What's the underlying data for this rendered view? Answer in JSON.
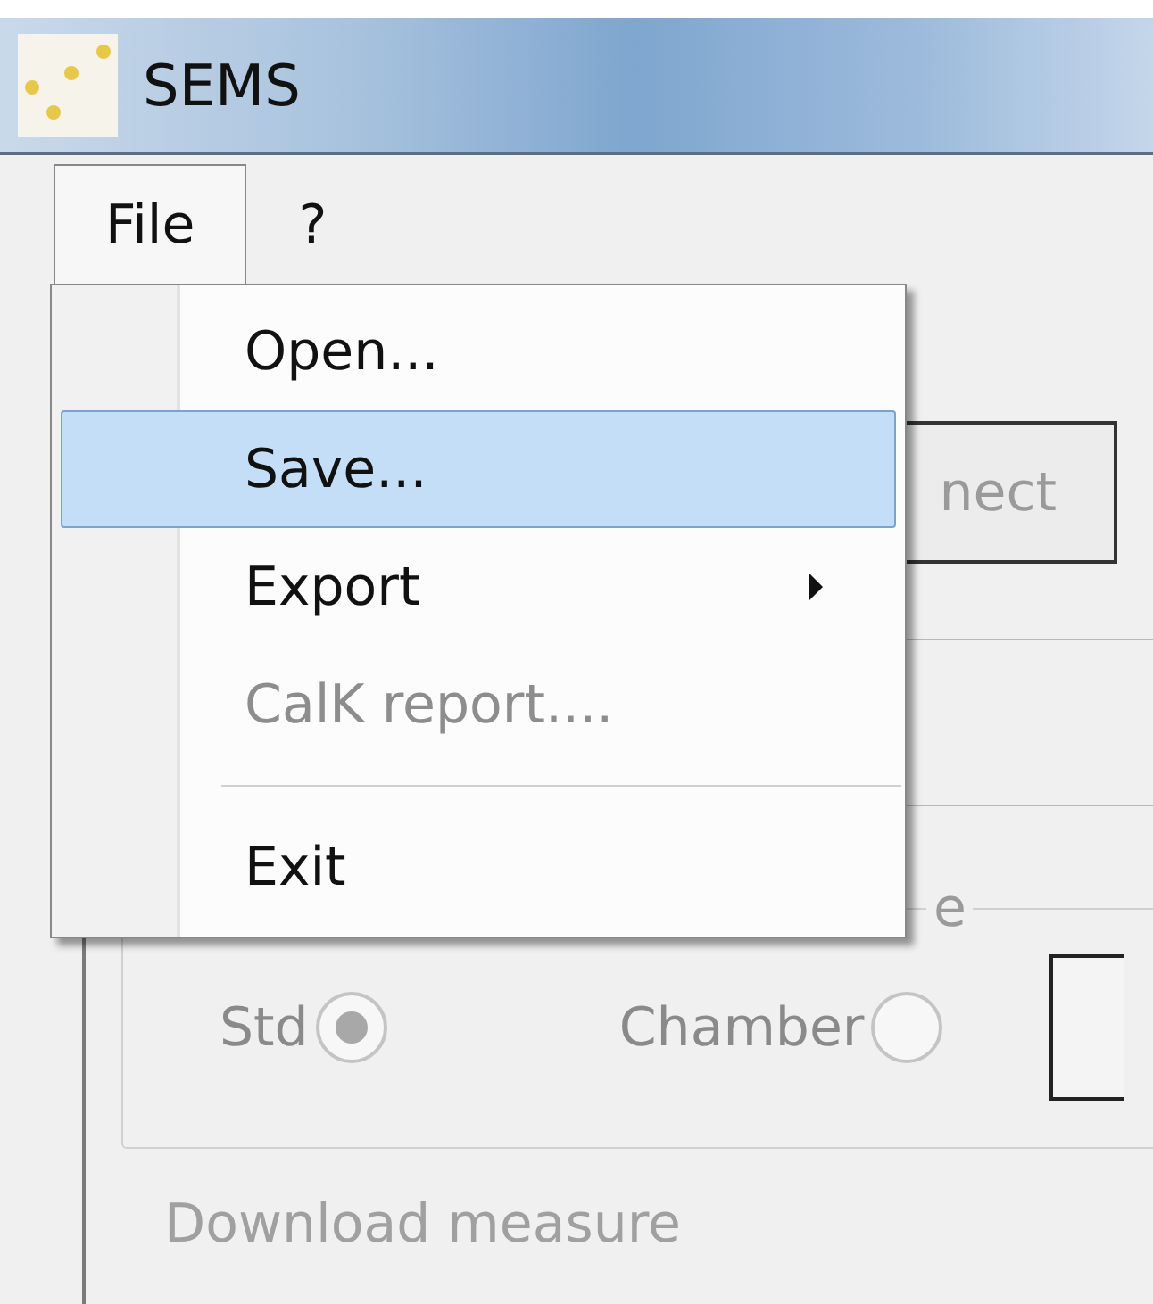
{
  "window": {
    "title": "SEMS"
  },
  "menu_bar": [
    {
      "label": "File",
      "selected": true
    },
    {
      "label": "?",
      "selected": false
    }
  ],
  "menu": {
    "items": [
      {
        "kind": "item",
        "label": "Open...",
        "selected": false,
        "disabled": false
      },
      {
        "kind": "item",
        "label": "Save...",
        "selected": true,
        "disabled": false
      },
      {
        "kind": "submenu",
        "label": "Export",
        "selected": false,
        "disabled": false
      },
      {
        "kind": "item",
        "label": "CalK report....",
        "selected": false,
        "disabled": true
      },
      {
        "kind": "separator"
      },
      {
        "kind": "item",
        "label": "Exit",
        "selected": false,
        "disabled": false
      }
    ]
  },
  "connect_button": {
    "label": "nect",
    "disabled": true
  },
  "source_group": {
    "legend": "e",
    "options": [
      {
        "label": "Std",
        "selected": true
      },
      {
        "label": "Chamber",
        "selected": false
      }
    ]
  },
  "download_group": {
    "legend": "Download measure"
  }
}
